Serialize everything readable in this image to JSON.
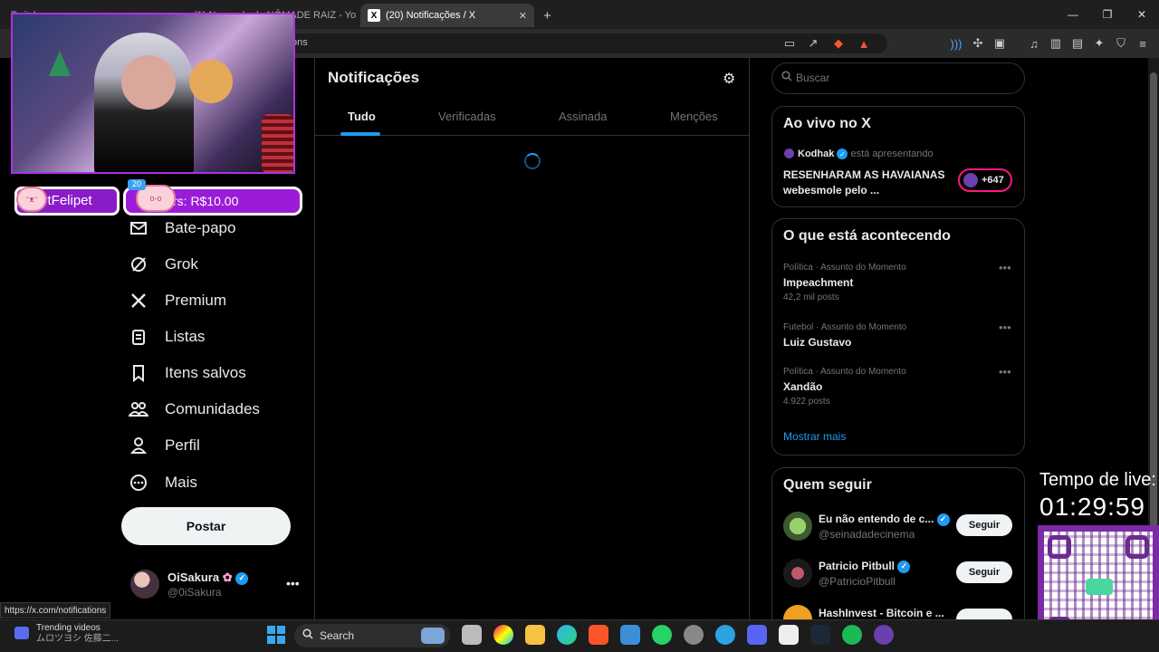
{
  "browser": {
    "tabs": [
      {
        "label": "Twitch"
      },
      {
        "label": "(1) Narrando de NÔMADE RAIZ - Yo"
      },
      {
        "label": "(20) Notificações / X"
      }
    ],
    "new_tab": "+",
    "url_fragment": "ons",
    "status_url": "https://x.com/notifications"
  },
  "stream": {
    "alert_name": "vtFelipet",
    "alert_badge": "20",
    "alert_amount": "rs: R$10.00",
    "timer_label": "Tempo de live:",
    "timer_value": "01:29:59"
  },
  "sidebar": {
    "items": [
      {
        "label": "Bate-papo",
        "icon": "mail-icon"
      },
      {
        "label": "Grok",
        "icon": "grok-icon"
      },
      {
        "label": "Premium",
        "icon": "x-logo-icon"
      },
      {
        "label": "Listas",
        "icon": "list-icon"
      },
      {
        "label": "Itens salvos",
        "icon": "bookmark-icon"
      },
      {
        "label": "Comunidades",
        "icon": "communities-icon"
      },
      {
        "label": "Perfil",
        "icon": "person-icon"
      },
      {
        "label": "Mais",
        "icon": "more-circle-icon"
      }
    ],
    "post_button": "Postar",
    "account": {
      "name": "OiSakura",
      "handle": "@0iSakura"
    }
  },
  "main": {
    "title": "Notificações",
    "tabs": [
      "Tudo",
      "Verificadas",
      "Assinada",
      "Menções"
    ],
    "active_tab": "Tudo"
  },
  "right": {
    "search_placeholder": "Buscar",
    "live": {
      "title": "Ao vivo no X",
      "host": "Kodhak",
      "host_action": "está apresentando",
      "line1": "RESENHARAM AS HAVAIANAS",
      "line2": "webesmole pelo ...",
      "listeners": "+647"
    },
    "trends": {
      "title": "O que está acontecendo",
      "items": [
        {
          "meta": "Política · Assunto do Momento",
          "name": "Impeachment",
          "posts": "42,2 mil posts"
        },
        {
          "meta": "Futebol · Assunto do Momento",
          "name": "Luiz Gustavo",
          "posts": ""
        },
        {
          "meta": "Política · Assunto do Momento",
          "name": "Xandão",
          "posts": "4.922 posts"
        }
      ],
      "show_more": "Mostrar mais"
    },
    "who_to_follow": {
      "title": "Quem seguir",
      "follow_label": "Seguir",
      "users": [
        {
          "name": "Eu não entendo de c...",
          "handle": "@seinadadecinema"
        },
        {
          "name": "Patricio Pitbull",
          "handle": "@PatricioPitbull"
        },
        {
          "name": "HashInvest - Bitcoin e ...",
          "handle": ""
        }
      ]
    }
  },
  "taskbar": {
    "trending_title": "Trending videos",
    "trending_sub": "ムロツヨシ 佐藤二...",
    "search_label": "Search"
  },
  "colors": {
    "accent": "#1d9bf0",
    "background": "#000000",
    "stream_purple": "#9a1cd8"
  }
}
